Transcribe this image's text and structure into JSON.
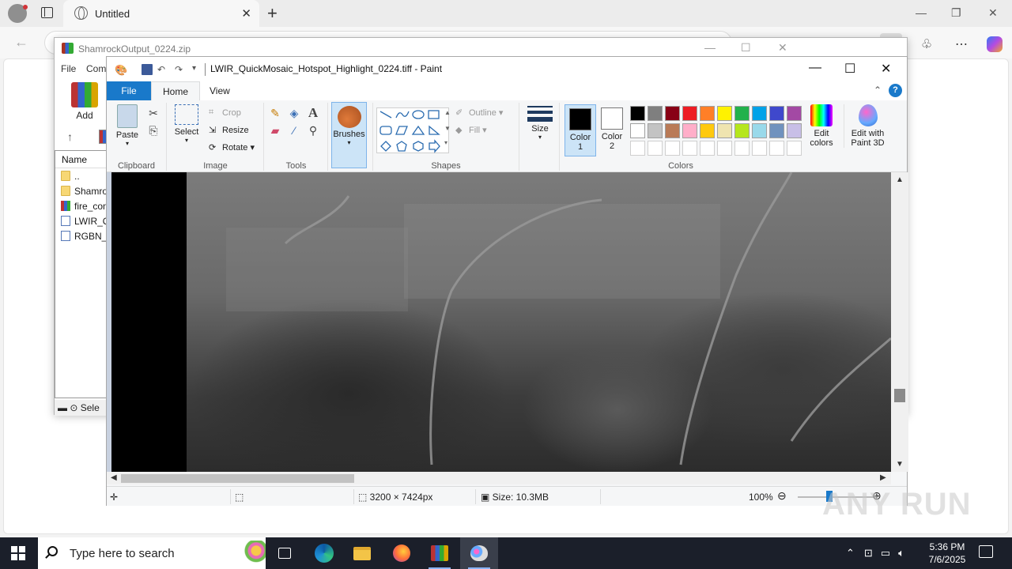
{
  "browser": {
    "tab_title": "Untitled",
    "new_tab_symbol": "+",
    "close_symbol": "✕",
    "window_controls": {
      "minimize": "—",
      "restore": "❐",
      "close": "✕"
    },
    "back_symbol": "←",
    "icons": [
      "favorites-icon",
      "collections-icon",
      "downloads-icon",
      "extensions-icon",
      "more-icon",
      "copilot-icon"
    ]
  },
  "winrar": {
    "title": "ShamrockOutput_0224.zip",
    "menu": [
      "File",
      "Com"
    ],
    "add_label": "Add",
    "list_header": "Name",
    "files": [
      {
        "name": "..",
        "type": "folder"
      },
      {
        "name": "Shamro",
        "type": "folder"
      },
      {
        "name": "fire_con",
        "type": "rar"
      },
      {
        "name": "LWIR_Q",
        "type": "img"
      },
      {
        "name": "RGBN_C",
        "type": "img"
      }
    ],
    "status": "Sele"
  },
  "paint": {
    "title": "LWIR_QuickMosaic_Hotspot_Highlight_0224.tiff - Paint",
    "tabs": {
      "file": "File",
      "home": "Home",
      "view": "View"
    },
    "clipboard": {
      "paste": "Paste",
      "group": "Clipboard"
    },
    "image": {
      "select": "Select",
      "crop": "Crop",
      "resize": "Resize",
      "rotate": "Rotate",
      "group": "Image"
    },
    "tools": {
      "group": "Tools"
    },
    "brushes": "Brushes",
    "shapes": {
      "outline": "Outline",
      "fill": "Fill",
      "group": "Shapes"
    },
    "size": "Size",
    "color1": {
      "label": "Color",
      "num": "1",
      "value": "#000000"
    },
    "color2": {
      "label": "Color",
      "num": "2",
      "value": "#ffffff"
    },
    "colors_group": "Colors",
    "palette_row1": [
      "#000000",
      "#7f7f7f",
      "#880015",
      "#ed1c24",
      "#ff7f27",
      "#fff200",
      "#22b14c",
      "#00a2e8",
      "#3f48cc",
      "#a349a4"
    ],
    "palette_row2": [
      "#ffffff",
      "#c3c3c3",
      "#b97a57",
      "#ffaec9",
      "#ffc90e",
      "#efe4b0",
      "#b5e61d",
      "#99d9ea",
      "#7092be",
      "#c8bfe7"
    ],
    "palette_row3_count": 10,
    "edit_colors": {
      "line1": "Edit",
      "line2": "colors"
    },
    "edit_3d": {
      "line1": "Edit with",
      "line2": "Paint 3D"
    },
    "status": {
      "dimensions": "3200 × 7424px",
      "size": "Size: 10.3MB",
      "zoom": "100%"
    }
  },
  "watermark": "ANY RUN",
  "taskbar": {
    "search_placeholder": "Type here to search",
    "time": "5:36 PM",
    "date": "7/6/2025"
  }
}
